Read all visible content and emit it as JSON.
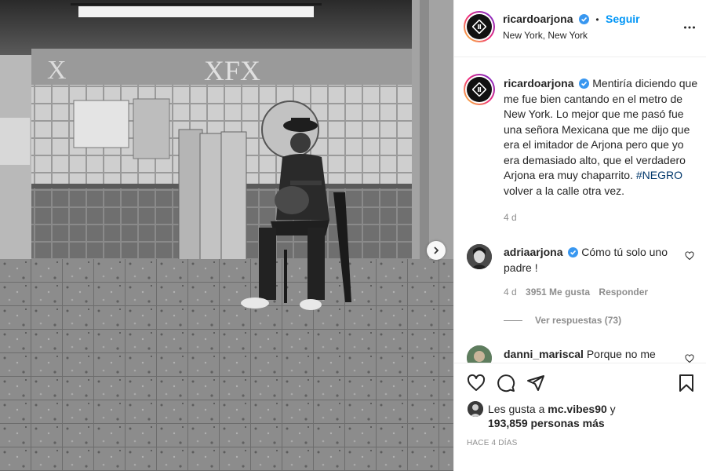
{
  "post": {
    "username": "ricardoarjona",
    "follow_label": "Seguir",
    "location": "New York, New York",
    "caption": "Mentiría diciendo que me fue bien cantando en el metro de New York. Lo mejor que me pasó fue una señora Mexicana que me dijo que era el imitador de Arjona pero que yo era demasiado alto, que el verdadero Arjona era muy chaparrito.",
    "hashtag": "#NEGRO",
    "caption_end": " volver a la calle otra vez.",
    "caption_age": "4 d"
  },
  "comments": [
    {
      "username": "adriaarjona",
      "text": "Cómo tú solo uno padre !",
      "age": "4 d",
      "likes": "3951 Me gusta",
      "reply_label": "Responder",
      "view_replies": "Ver respuestas (73)"
    },
    {
      "username": "danni_mariscal",
      "text": "Porque no me"
    }
  ],
  "likes": {
    "prefix": "Les gusta a",
    "user": "mc.vibes90",
    "conj": "y",
    "count": "193,859",
    "suffix": "personas más"
  },
  "timestamp": "Hace 4 días",
  "icons": {
    "more": "more-options-icon",
    "like": "heart-icon",
    "comment": "comment-icon",
    "share": "share-icon",
    "save": "bookmark-icon",
    "next": "chevron-right-icon",
    "verified": "verified-badge-icon"
  },
  "colors": {
    "accent": "#0095f6",
    "hashtag": "#00376b",
    "muted": "#8e8e8e",
    "text": "#262626"
  }
}
